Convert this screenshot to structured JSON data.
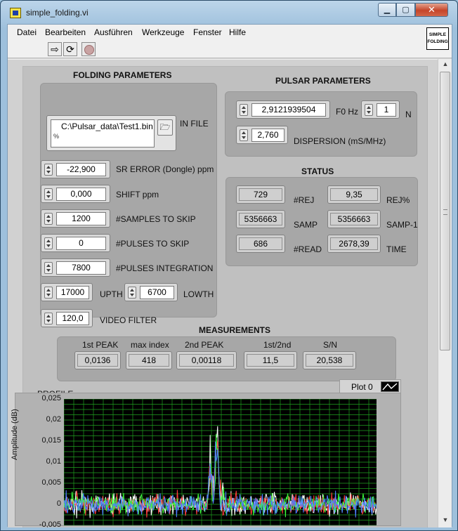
{
  "window": {
    "title": "simple_folding.vi",
    "min_glyph": "▁",
    "max_glyph": "▢",
    "close_glyph": "✕"
  },
  "menu": [
    "Datei",
    "Bearbeiten",
    "Ausführen",
    "Werkzeuge",
    "Fenster",
    "Hilfe"
  ],
  "toolbar": {
    "run_glyph": "⇨",
    "run_cont_glyph": "⟳"
  },
  "vi_icon": [
    "SIMPLE",
    "FOLDING"
  ],
  "folding": {
    "heading": "FOLDING PARAMETERS",
    "in_file": {
      "label": "IN FILE",
      "value": "C:\\Pulsar_data\\Test1.bin",
      "path_glyph": "%"
    },
    "sr_error": {
      "label": "SR ERROR (Dongle) ppm",
      "value": "-22,900"
    },
    "shift": {
      "label": "SHIFT ppm",
      "value": "0,000"
    },
    "samples_skip": {
      "label": "#SAMPLES TO SKIP",
      "value": "1200"
    },
    "pulses_skip": {
      "label": "#PULSES TO SKIP",
      "value": "0"
    },
    "pulses_int": {
      "label": "#PULSES INTEGRATION",
      "value": "7800"
    },
    "upth": {
      "label": "UPTH",
      "value": "17000"
    },
    "lowth": {
      "label": "LOWTH",
      "value": "6700"
    },
    "video_filter": {
      "label": "VIDEO FILTER",
      "value": "120,0"
    }
  },
  "pulsar": {
    "heading": "PULSAR PARAMETERS",
    "f0": {
      "label": "F0 Hz",
      "value": "2,9121939504"
    },
    "n": {
      "label": "N",
      "value": "1"
    },
    "dispersion": {
      "label": "DISPERSION (mS/MHz)",
      "value": "2,760"
    }
  },
  "status": {
    "heading": "STATUS",
    "rej": {
      "label": "#REJ",
      "value": "729"
    },
    "rej_pct": {
      "label": "REJ%",
      "value": "9,35"
    },
    "samp": {
      "label": "SAMP",
      "value": "5356663"
    },
    "samp1": {
      "label": "SAMP-1",
      "value": "5356663"
    },
    "read": {
      "label": "#READ",
      "value": "686"
    },
    "time": {
      "label": "TIME",
      "value": "2678,39"
    }
  },
  "measurements": {
    "heading": "MEASUREMENTS",
    "first_peak": {
      "label": "1st PEAK",
      "value": "0,0136"
    },
    "max_index": {
      "label": "max index",
      "value": "418"
    },
    "second_peak": {
      "label": "2nd PEAK",
      "value": "0,00118"
    },
    "ratio": {
      "label": "1st/2nd",
      "value": "11,5"
    },
    "sn": {
      "label": "S/N",
      "value": "20,538"
    }
  },
  "chart_data": {
    "type": "line",
    "title": "PROFILE",
    "legend": [
      "Plot 0"
    ],
    "ylabel": "Amplitude (dB)",
    "xlabel": "",
    "ylim": [
      -0.005,
      0.025
    ],
    "yticks": [
      "0,025",
      "0,02",
      "0,015",
      "0,01",
      "0,005",
      "0",
      "-0,005"
    ],
    "grid": true,
    "background": "#000000",
    "grid_color": "#1fa01f",
    "series_colors": [
      "#ffffff",
      "#ff3b3b",
      "#3bff3b",
      "#4d7dff"
    ],
    "n_points": 420,
    "peak_index": 205,
    "peak_value": 0.0136,
    "secondary_index": 196,
    "secondary_value": 0.0095,
    "noise_level": 0.0018
  }
}
